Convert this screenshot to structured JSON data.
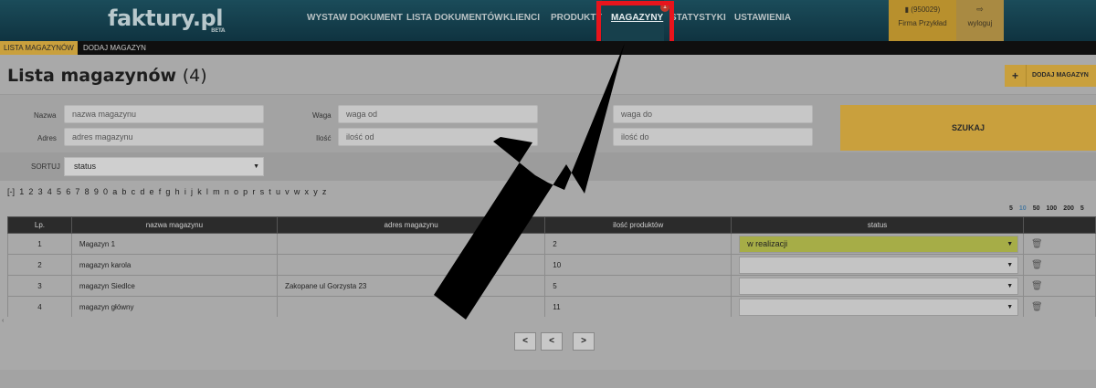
{
  "topnav": {
    "logo": "faktury.pl",
    "logo_beta": "BETA",
    "items": [
      {
        "label": "WYSTAW DOKUMENT"
      },
      {
        "label": "LISTA DOKUMENTÓW"
      },
      {
        "label": "KLIENCI"
      },
      {
        "label": "PRODUKTY"
      },
      {
        "label": "MAGAZYNY"
      },
      {
        "label": "STATYSTYKI"
      },
      {
        "label": "USTAWIENIA"
      }
    ],
    "active_badge": "1",
    "user_id": "(950029)",
    "user_name": "Firma Przykład",
    "logout_label": "wyloguj"
  },
  "subnav": {
    "items": [
      {
        "label": "LISTA MAGAZYNÓW"
      },
      {
        "label": "DODAJ MAGAZYN"
      }
    ]
  },
  "page": {
    "title": "Lista magazynów",
    "count": "(4)",
    "add_label": "DODAJ MAGAZYN",
    "add_symbol": "+"
  },
  "filters": {
    "name_label": "Nazwa",
    "name_placeholder": "nazwa magazynu",
    "address_label": "Adres",
    "address_placeholder": "adres magazynu",
    "weight_label": "Waga",
    "weight_from_placeholder": "waga od",
    "weight_to_placeholder": "waga do",
    "qty_label": "Ilość",
    "qty_from_placeholder": "ilość od",
    "qty_to_placeholder": "ilość do",
    "qty_to_label_fragment": "o",
    "search_label": "SZUKAJ",
    "sort_label": "SORTUJ",
    "sort_value": "status"
  },
  "letters": [
    "[-]",
    "1",
    "2",
    "3",
    "4",
    "5",
    "6",
    "7",
    "8",
    "9",
    "0",
    "a",
    "b",
    "c",
    "d",
    "e",
    "f",
    "g",
    "h",
    "i",
    "j",
    "k",
    "l",
    "m",
    "n",
    "o",
    "p",
    "r",
    "s",
    "t",
    "u",
    "v",
    "w",
    "x",
    "y",
    "z"
  ],
  "page_sizes": [
    "5",
    "10",
    "50",
    "100",
    "200",
    "5"
  ],
  "table": {
    "headers": [
      "Lp.",
      "nazwa magazynu",
      "adres magazynu",
      "ilość produktów",
      "status"
    ],
    "rows": [
      {
        "lp": "1",
        "name": "Magazyn 1",
        "address": "",
        "qty": "2",
        "status": "w realizacji"
      },
      {
        "lp": "2",
        "name": "magazyn karola",
        "address": "",
        "qty": "10",
        "status": ""
      },
      {
        "lp": "3",
        "name": "magazyn Siedlce",
        "address": "Zakopane ul Gorzysta 23",
        "qty": "5",
        "status": ""
      },
      {
        "lp": "4",
        "name": "magazyn główny",
        "address": "",
        "qty": "11",
        "status": ""
      }
    ]
  },
  "pagination": {
    "first": "<",
    "prev": "<",
    "next": ">"
  },
  "colors": {
    "topbar": "#1b4c5a",
    "accent_gold": "#c9a03d",
    "highlight_red": "#e8141c",
    "status_green": "#a6ad47"
  }
}
